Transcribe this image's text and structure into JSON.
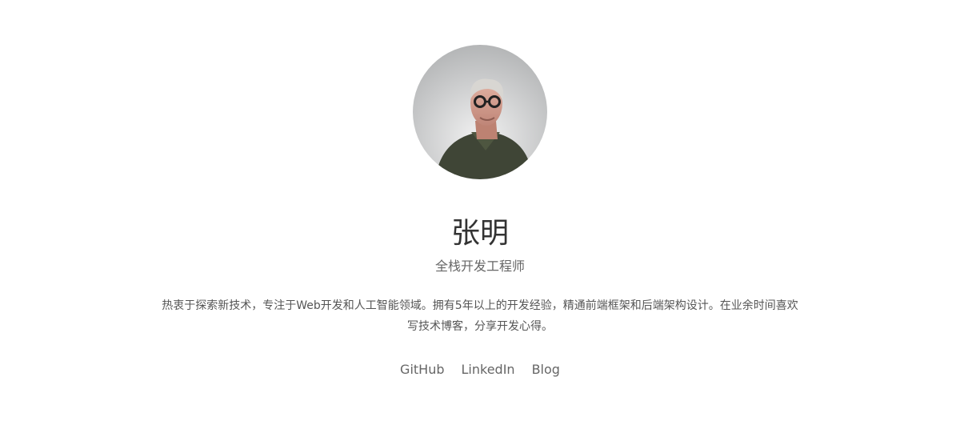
{
  "profile": {
    "name": "张明",
    "title": "全栈开发工程师",
    "bio": "热衷于探索新技术，专注于Web开发和人工智能领域。拥有5年以上的开发经验，精通前端框架和后端架构设计。在业余时间喜欢写技术博客，分享开发心得。",
    "avatar_alt": "张明"
  },
  "links": [
    {
      "label": "GitHub"
    },
    {
      "label": "LinkedIn"
    },
    {
      "label": "Blog"
    }
  ],
  "colors": {
    "background": "#ffffff",
    "name_text": "#333333",
    "secondary_text": "#666666",
    "body_text": "#555555"
  }
}
